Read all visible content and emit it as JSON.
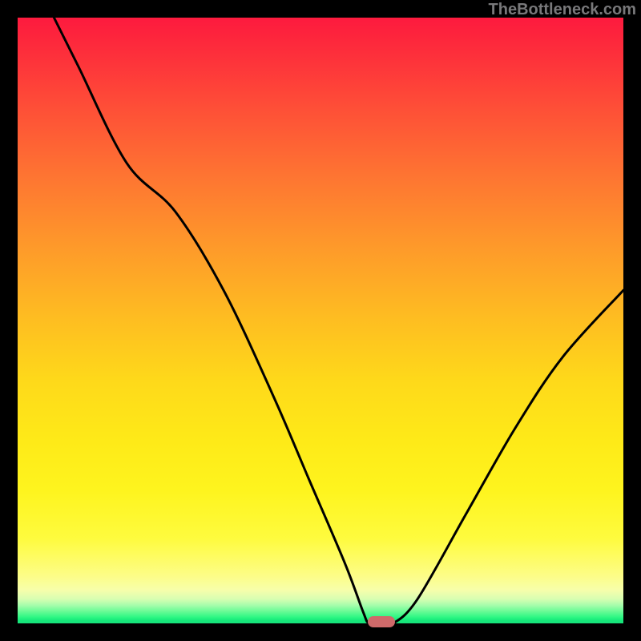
{
  "watermark": "TheBottleneck.com",
  "chart_data": {
    "type": "line",
    "title": "",
    "xlabel": "",
    "ylabel": "",
    "xlim": [
      0,
      100
    ],
    "ylim": [
      0,
      100
    ],
    "grid": false,
    "legend": false,
    "series": [
      {
        "name": "bottleneck-curve",
        "x": [
          6,
          10,
          18,
          26,
          34,
          42,
          48,
          54,
          57,
          58,
          60,
          62,
          66,
          74,
          82,
          90,
          100
        ],
        "y": [
          100,
          92,
          76,
          68,
          55,
          38,
          24,
          10,
          2,
          0,
          0,
          0,
          4,
          18,
          32,
          44,
          55
        ]
      }
    ],
    "annotations": [
      {
        "name": "min-marker",
        "x": 60,
        "y": 0,
        "color": "#cf6a6a"
      }
    ],
    "background_gradient": {
      "top": "#fd1a3e",
      "mid": "#fed91a",
      "bottom": "#17e07a"
    }
  }
}
